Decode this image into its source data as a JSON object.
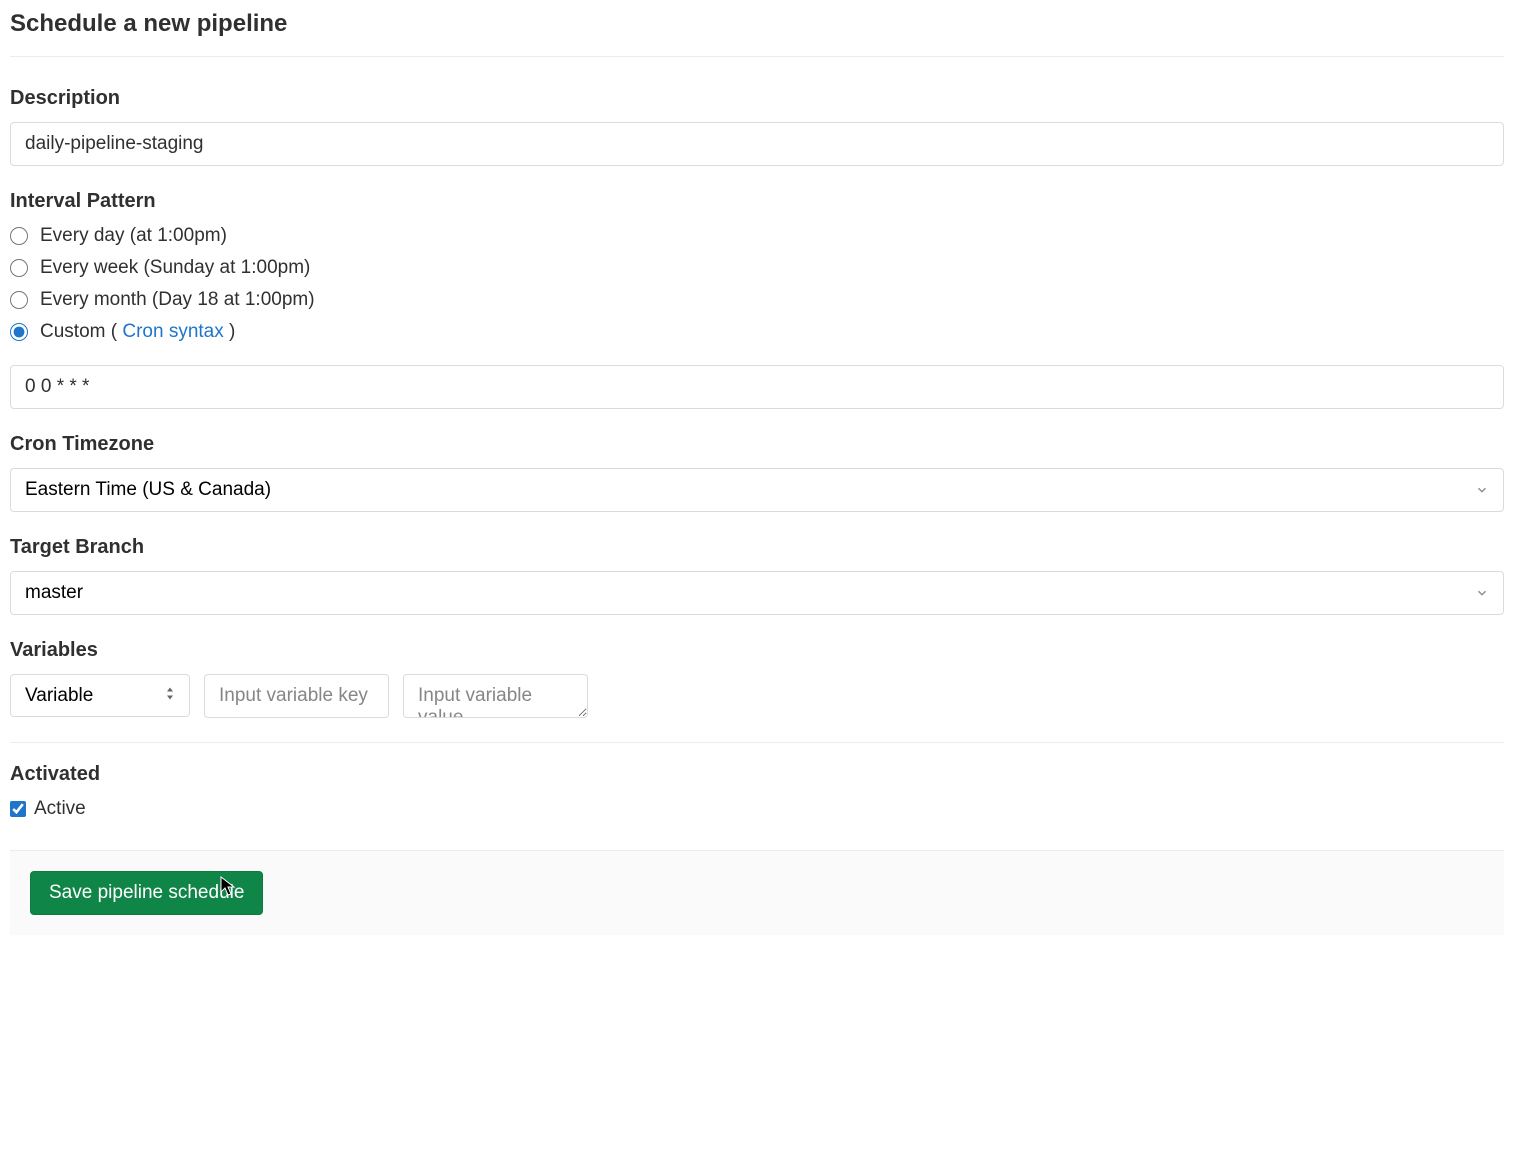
{
  "header": {
    "title": "Schedule a new pipeline"
  },
  "description": {
    "label": "Description",
    "value": "daily-pipeline-staging"
  },
  "interval": {
    "label": "Interval Pattern",
    "options": {
      "day": "Every day (at 1:00pm)",
      "week": "Every week (Sunday at 1:00pm)",
      "month": "Every month (Day 18 at 1:00pm)",
      "custom_prefix": "Custom ( ",
      "custom_link": "Cron syntax",
      "custom_suffix": " )"
    },
    "selected": "custom",
    "cron_value": "0 0 * * *"
  },
  "timezone": {
    "label": "Cron Timezone",
    "value": "Eastern Time (US & Canada)"
  },
  "branch": {
    "label": "Target Branch",
    "value": "master"
  },
  "variables": {
    "label": "Variables",
    "type_selected": "Variable",
    "key_placeholder": "Input variable key",
    "value_placeholder": "Input variable value"
  },
  "activated": {
    "label": "Activated",
    "checkbox_label": "Active",
    "checked": true
  },
  "buttons": {
    "save": "Save pipeline schedule"
  }
}
